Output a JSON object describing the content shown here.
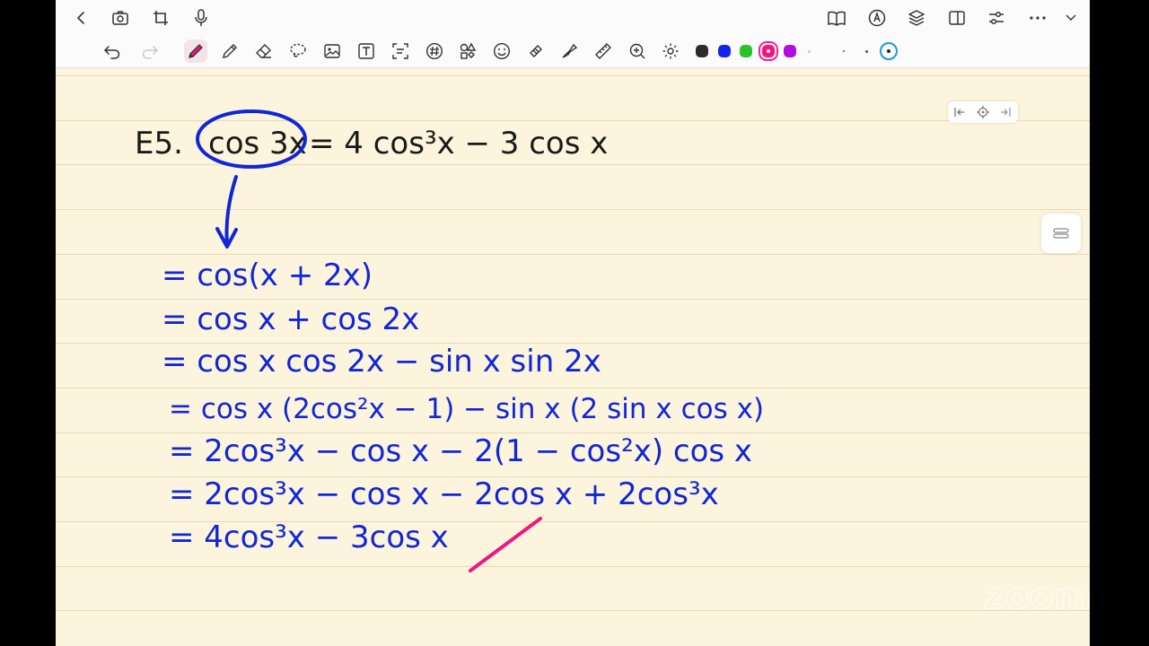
{
  "window": {
    "left_tools": [
      "back-icon",
      "camera-icon",
      "crop-icon",
      "microphone-icon"
    ],
    "right_tools": [
      "book-icon",
      "pen-circle-icon",
      "layers-icon",
      "split-view-icon",
      "sliders-icon",
      "more-icon",
      "chevron-down-icon"
    ]
  },
  "toolbar": {
    "tools": [
      "undo-icon",
      "redo-icon",
      "pen-icon",
      "pencil-icon",
      "eraser-icon",
      "lasso-icon",
      "image-icon",
      "text-icon",
      "scan-text-icon",
      "hash-icon",
      "shapes-icon",
      "sticker-icon",
      "tape-icon",
      "highlighter-icon",
      "ruler-icon",
      "zoom-icon",
      "settings-icon"
    ],
    "active_tool": "pen-icon",
    "colors": [
      "#2b2b2b",
      "#1424e8",
      "#2ac22a",
      "#f5137f",
      "#b20de0"
    ],
    "selected_color": "#f5137f",
    "sizes": [
      "small",
      "medium",
      "large"
    ],
    "selected_size": "large"
  },
  "notebook": {
    "paper_color": "#fcf4dc",
    "ink_blue": "#1126d6",
    "ink_black": "#1a1a1a",
    "ink_pink": "#ee1680",
    "handwriting": {
      "example_label": "E5.",
      "statement_lhs": "cos 3x",
      "statement_rhs": "= 4 cos³x − 3 cos x",
      "steps": [
        "= cos(x + 2x)",
        "= cos x + cos 2x",
        "= cos x cos 2x − sin x sin 2x",
        "= cos x (2cos²x − 1) − sin x (2 sin x cos x)",
        "= 2cos³x − cos x − 2(1 − cos²x) cos x",
        "= 2cos³x − cos x − 2cos x + 2cos³x",
        "= 4cos³x − 3cos x"
      ],
      "check_mark": "✓"
    }
  },
  "page_nav": [
    "first-page-icon",
    "locate-icon",
    "last-page-icon"
  ],
  "watermark": {
    "text": "zoom"
  }
}
